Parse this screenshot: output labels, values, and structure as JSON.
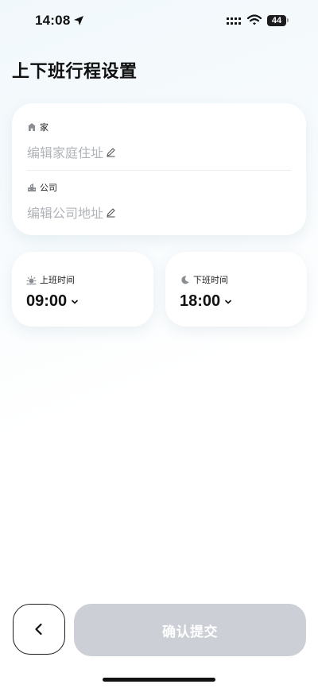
{
  "status_bar": {
    "time": "14:08",
    "battery": "44"
  },
  "page": {
    "title": "上下班行程设置"
  },
  "address_card": {
    "home": {
      "label": "家",
      "value": "编辑家庭住址",
      "icon": "home-icon"
    },
    "company": {
      "label": "公司",
      "value": "编辑公司地址",
      "icon": "company-icon"
    }
  },
  "schedule": {
    "start": {
      "label": "上班时间",
      "value": "09:00",
      "icon": "sunrise-icon"
    },
    "end": {
      "label": "下班时间",
      "value": "18:00",
      "icon": "moon-icon"
    }
  },
  "footer": {
    "submit_label": "确认提交",
    "submit_color": "#ccd0d6"
  }
}
